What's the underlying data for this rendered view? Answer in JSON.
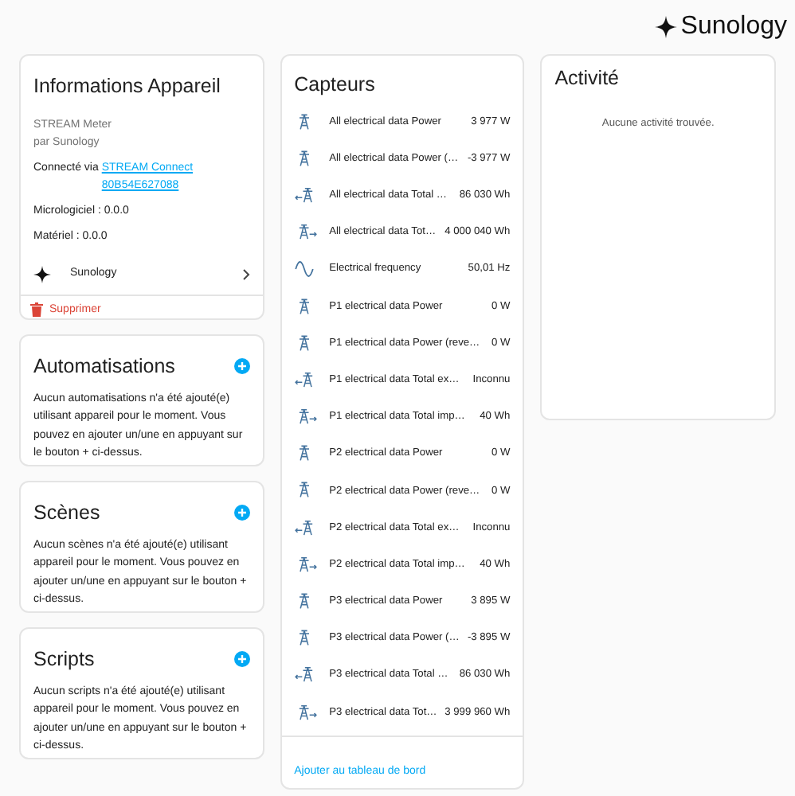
{
  "brand": {
    "name": "Sunology"
  },
  "device": {
    "title": "Informations Appareil",
    "model": "STREAM Meter",
    "maker": "par Sunology",
    "connected_prefix": "Connecté via",
    "connected_link": "STREAM Connect 80B54E627088",
    "firmware": "Micrologiciel : 0.0.0",
    "hardware": "Matériel : 0.0.0",
    "integration": "Sunology",
    "delete": "Supprimer"
  },
  "sections": [
    {
      "title": "Automatisations",
      "text": "Aucun automatisations n'a été ajouté(e) utilisant appareil pour le moment. Vous pouvez en ajouter un/une en appuyant sur le bouton + ci-dessus."
    },
    {
      "title": "Scènes",
      "text": "Aucun scènes n'a été ajouté(e) utilisant appareil pour le moment. Vous pouvez en ajouter un/une en appuyant sur le bouton + ci-dessus."
    },
    {
      "title": "Scripts",
      "text": "Aucun scripts n'a été ajouté(e) utilisant appareil pour le moment. Vous pouvez en ajouter un/une en appuyant sur le bouton + ci-dessus."
    }
  ],
  "sensors": {
    "title": "Capteurs",
    "add": "Ajouter au tableau de bord",
    "items": [
      {
        "kind": "tower",
        "name": "All electrical data Power",
        "value": "3 977 W"
      },
      {
        "kind": "tower",
        "name": "All electrical data Power (…",
        "value": "-3 977 W"
      },
      {
        "kind": "export",
        "name": "All electrical data Total …",
        "value": "86 030 Wh"
      },
      {
        "kind": "import",
        "name": "All electrical data Tot…",
        "value": "4 000 040 Wh"
      },
      {
        "kind": "wave",
        "name": "Electrical frequency",
        "value": "50,01 Hz"
      },
      {
        "kind": "tower",
        "name": "P1 electrical data Power",
        "value": "0 W"
      },
      {
        "kind": "tower",
        "name": "P1 electrical data Power (reve…",
        "value": "0 W"
      },
      {
        "kind": "export",
        "name": "P1 electrical data Total ex…",
        "value": "Inconnu"
      },
      {
        "kind": "import",
        "name": "P1 electrical data Total imp…",
        "value": "40 Wh"
      },
      {
        "kind": "tower",
        "name": "P2 electrical data Power",
        "value": "0 W"
      },
      {
        "kind": "tower",
        "name": "P2 electrical data Power (reve…",
        "value": "0 W"
      },
      {
        "kind": "export",
        "name": "P2 electrical data Total ex…",
        "value": "Inconnu"
      },
      {
        "kind": "import",
        "name": "P2 electrical data Total imp…",
        "value": "40 Wh"
      },
      {
        "kind": "tower",
        "name": "P3 electrical data Power",
        "value": "3 895 W"
      },
      {
        "kind": "tower",
        "name": "P3 electrical data Power (…",
        "value": "-3 895 W"
      },
      {
        "kind": "export",
        "name": "P3 electrical data Total …",
        "value": "86 030 Wh"
      },
      {
        "kind": "import",
        "name": "P3 electrical data Tot…",
        "value": "3 999 960 Wh"
      }
    ]
  },
  "activity": {
    "title": "Activité",
    "empty": "Aucune activité trouvée."
  }
}
